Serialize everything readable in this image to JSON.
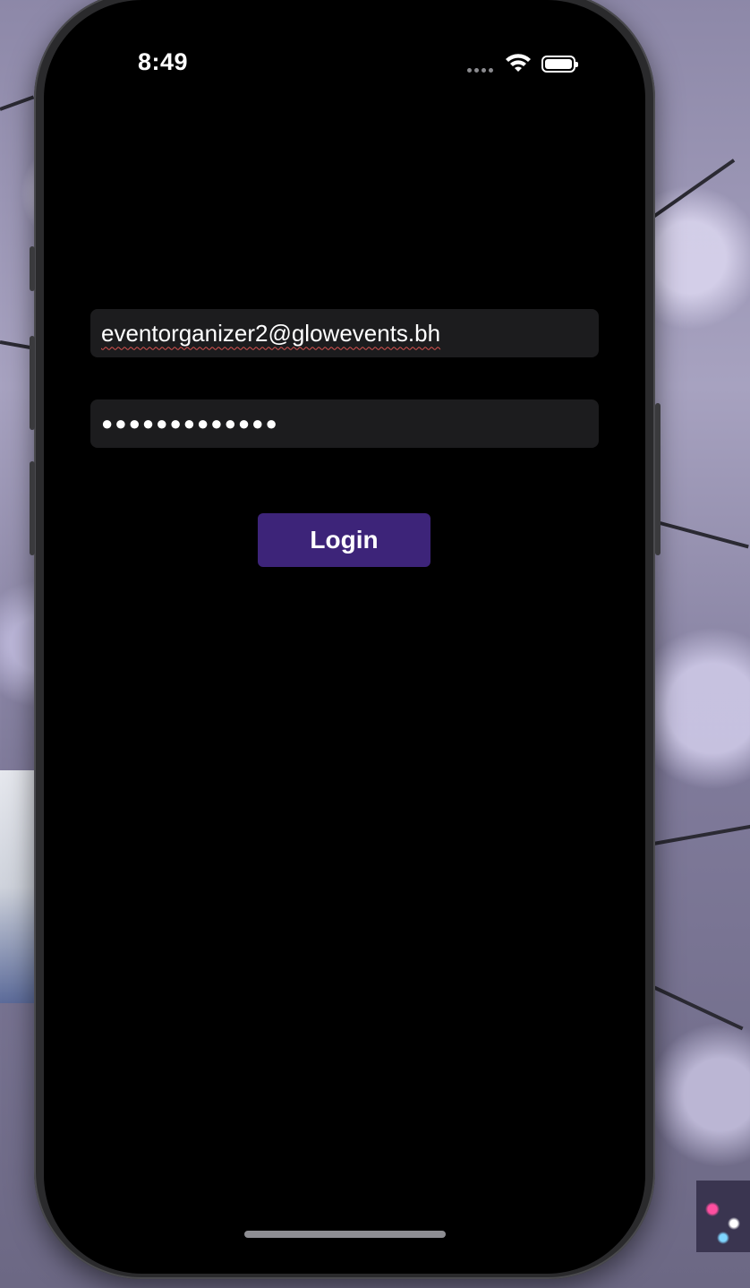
{
  "status_bar": {
    "time": "8:49",
    "signal_icon": "cellular-dots-icon",
    "wifi_icon": "wifi-icon",
    "battery_icon": "battery-full-icon"
  },
  "login_form": {
    "email_value": "eventorganizer2@glowevents.bh",
    "password_masked": "●●●●●●●●●●●●●",
    "login_label": "Login"
  },
  "colors": {
    "screen_bg": "#000000",
    "field_bg": "#1c1c1e",
    "button_bg": "#3d2479",
    "text": "#ffffff"
  }
}
